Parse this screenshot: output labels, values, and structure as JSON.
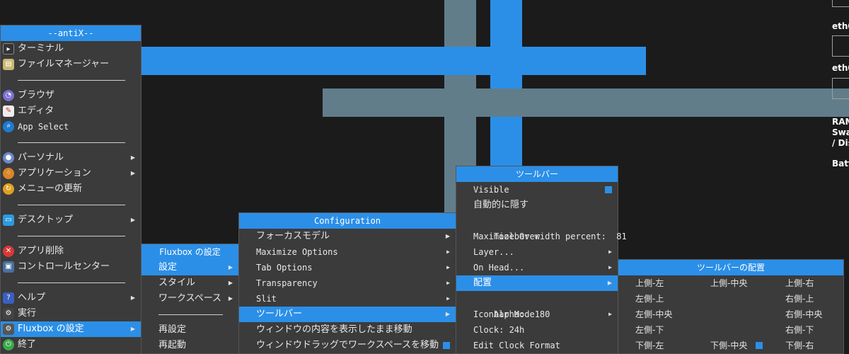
{
  "main_menu": {
    "title": "--antiX--",
    "items": [
      {
        "label": "ターミナル",
        "icon": "terminal-icon"
      },
      {
        "label": "ファイルマネージャー",
        "icon": "file-manager-icon"
      },
      {
        "label": "ブラウザ",
        "icon": "browser-icon"
      },
      {
        "label": "エディタ",
        "icon": "editor-icon"
      },
      {
        "label": "App Select",
        "icon": "app-select-icon"
      },
      {
        "label": "パーソナル",
        "icon": "person-icon"
      },
      {
        "label": "アプリケーション",
        "icon": "applications-icon"
      },
      {
        "label": "メニューの更新",
        "icon": "refresh-icon"
      },
      {
        "label": "デスクトップ",
        "icon": "desktop-icon"
      },
      {
        "label": "アプリ削除",
        "icon": "remove-icon"
      },
      {
        "label": "コントロールセンター",
        "icon": "control-center-icon"
      },
      {
        "label": "ヘルプ",
        "icon": "help-icon"
      },
      {
        "label": "実行",
        "icon": "run-icon"
      },
      {
        "label": "Fluxbox の設定",
        "icon": "fluxbox-icon"
      },
      {
        "label": "終了",
        "icon": "exit-icon"
      }
    ]
  },
  "fluxbox_menu": {
    "title": "Fluxbox の設定",
    "items": [
      "設定",
      "スタイル",
      "ワークスペース",
      "再設定",
      "再起動"
    ]
  },
  "config_menu": {
    "title": "Configuration",
    "items": [
      "フォーカスモデル",
      "Maximize Options",
      "Tab Options",
      "Transparency",
      "Slit",
      "ツールバー",
      "ウィンドウの内容を表示したまま移動",
      "ウィンドウドラッグでワークスペースを移動"
    ]
  },
  "toolbar_menu": {
    "title": "ツールバー",
    "items": [
      "Visible",
      "自動的に隠す",
      "Toolbar width percent:  81",
      "Maximize Over",
      "Layer...",
      "On Head...",
      "配置",
      "Alpha:  180",
      "Iconbar Mode",
      "Clock: 24h",
      "Edit Clock Format"
    ]
  },
  "placement_menu": {
    "title": "ツールバーの配置",
    "top_left": "上側-左",
    "top_center": "上側-中央",
    "top_right": "上側-右",
    "left_top": "左側-上",
    "right_top": "右側-上",
    "left_center": "左側-中央",
    "right_center": "右側-中央",
    "left_bottom": "左側-下",
    "right_bottom": "右側-下",
    "bottom_left": "下側-左",
    "bottom_center": "下側-中央",
    "bottom_right": "下側-右"
  },
  "conky": {
    "eth_label_1": "eth0",
    "eth_label_2": "eth0",
    "ram": "RAM",
    "swap": "Swa",
    "disk": "/ Dis",
    "battery": "Batt"
  },
  "colors": {
    "accent": "#2b8fe8",
    "menu_bg": "#3b3b3b",
    "desktop_bg": "#1b1b1c",
    "wallpaper_gray": "#627d8a"
  }
}
